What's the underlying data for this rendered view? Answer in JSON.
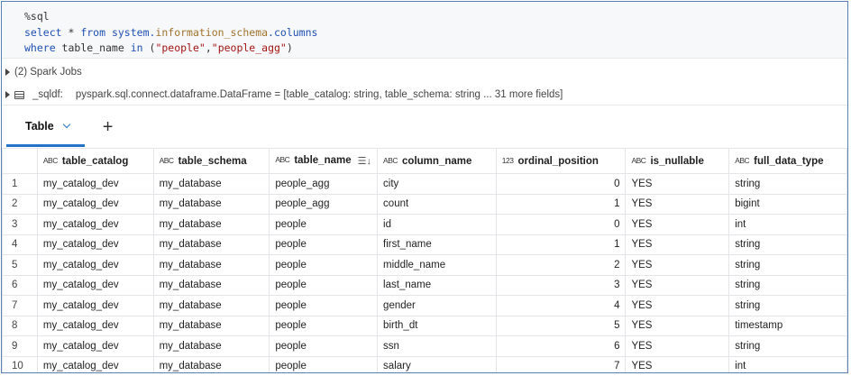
{
  "code": {
    "magic": "%sql",
    "line2": {
      "kw1": "select",
      "mid": " * ",
      "kw2": "from",
      "ns": " system.",
      "schema": "information_schema",
      "dot": ".",
      "tbl": "columns"
    },
    "line3": {
      "kw1": "where",
      "mid": " table_name ",
      "kw2": "in",
      "open": " (",
      "s1": "\"people\"",
      "comma": ",",
      "s2": "\"people_agg\"",
      "close": ")"
    }
  },
  "spark_jobs": "(2) Spark Jobs",
  "dataframe": {
    "name": "_sqldf:",
    "type": "pyspark.sql.connect.dataframe.DataFrame = [table_catalog: string, table_schema: string ... 31 more fields]"
  },
  "tabs": {
    "active": "Table",
    "add": "+"
  },
  "table": {
    "columns": [
      {
        "type_icon": "ABC",
        "label": "table_catalog"
      },
      {
        "type_icon": "ABC",
        "label": "table_schema"
      },
      {
        "type_icon": "ABC",
        "label": "table_name"
      },
      {
        "type_icon": "ABC",
        "label": "column_name"
      },
      {
        "type_icon": "123",
        "label": "ordinal_position"
      },
      {
        "type_icon": "ABC",
        "label": "is_nullable"
      },
      {
        "type_icon": "ABC",
        "label": "full_data_type"
      }
    ],
    "rows": [
      {
        "n": "1",
        "cells": [
          "my_catalog_dev",
          "my_database",
          "people_agg",
          "city",
          "0",
          "YES",
          "string"
        ]
      },
      {
        "n": "2",
        "cells": [
          "my_catalog_dev",
          "my_database",
          "people_agg",
          "count",
          "1",
          "YES",
          "bigint"
        ]
      },
      {
        "n": "3",
        "cells": [
          "my_catalog_dev",
          "my_database",
          "people",
          "id",
          "0",
          "YES",
          "int"
        ]
      },
      {
        "n": "4",
        "cells": [
          "my_catalog_dev",
          "my_database",
          "people",
          "first_name",
          "1",
          "YES",
          "string"
        ]
      },
      {
        "n": "5",
        "cells": [
          "my_catalog_dev",
          "my_database",
          "people",
          "middle_name",
          "2",
          "YES",
          "string"
        ]
      },
      {
        "n": "6",
        "cells": [
          "my_catalog_dev",
          "my_database",
          "people",
          "last_name",
          "3",
          "YES",
          "string"
        ]
      },
      {
        "n": "7",
        "cells": [
          "my_catalog_dev",
          "my_database",
          "people",
          "gender",
          "4",
          "YES",
          "string"
        ]
      },
      {
        "n": "8",
        "cells": [
          "my_catalog_dev",
          "my_database",
          "people",
          "birth_dt",
          "5",
          "YES",
          "timestamp"
        ]
      },
      {
        "n": "9",
        "cells": [
          "my_catalog_dev",
          "my_database",
          "people",
          "ssn",
          "6",
          "YES",
          "string"
        ]
      },
      {
        "n": "10",
        "cells": [
          "my_catalog_dev",
          "my_database",
          "people",
          "salary",
          "7",
          "YES",
          "int"
        ]
      }
    ]
  }
}
